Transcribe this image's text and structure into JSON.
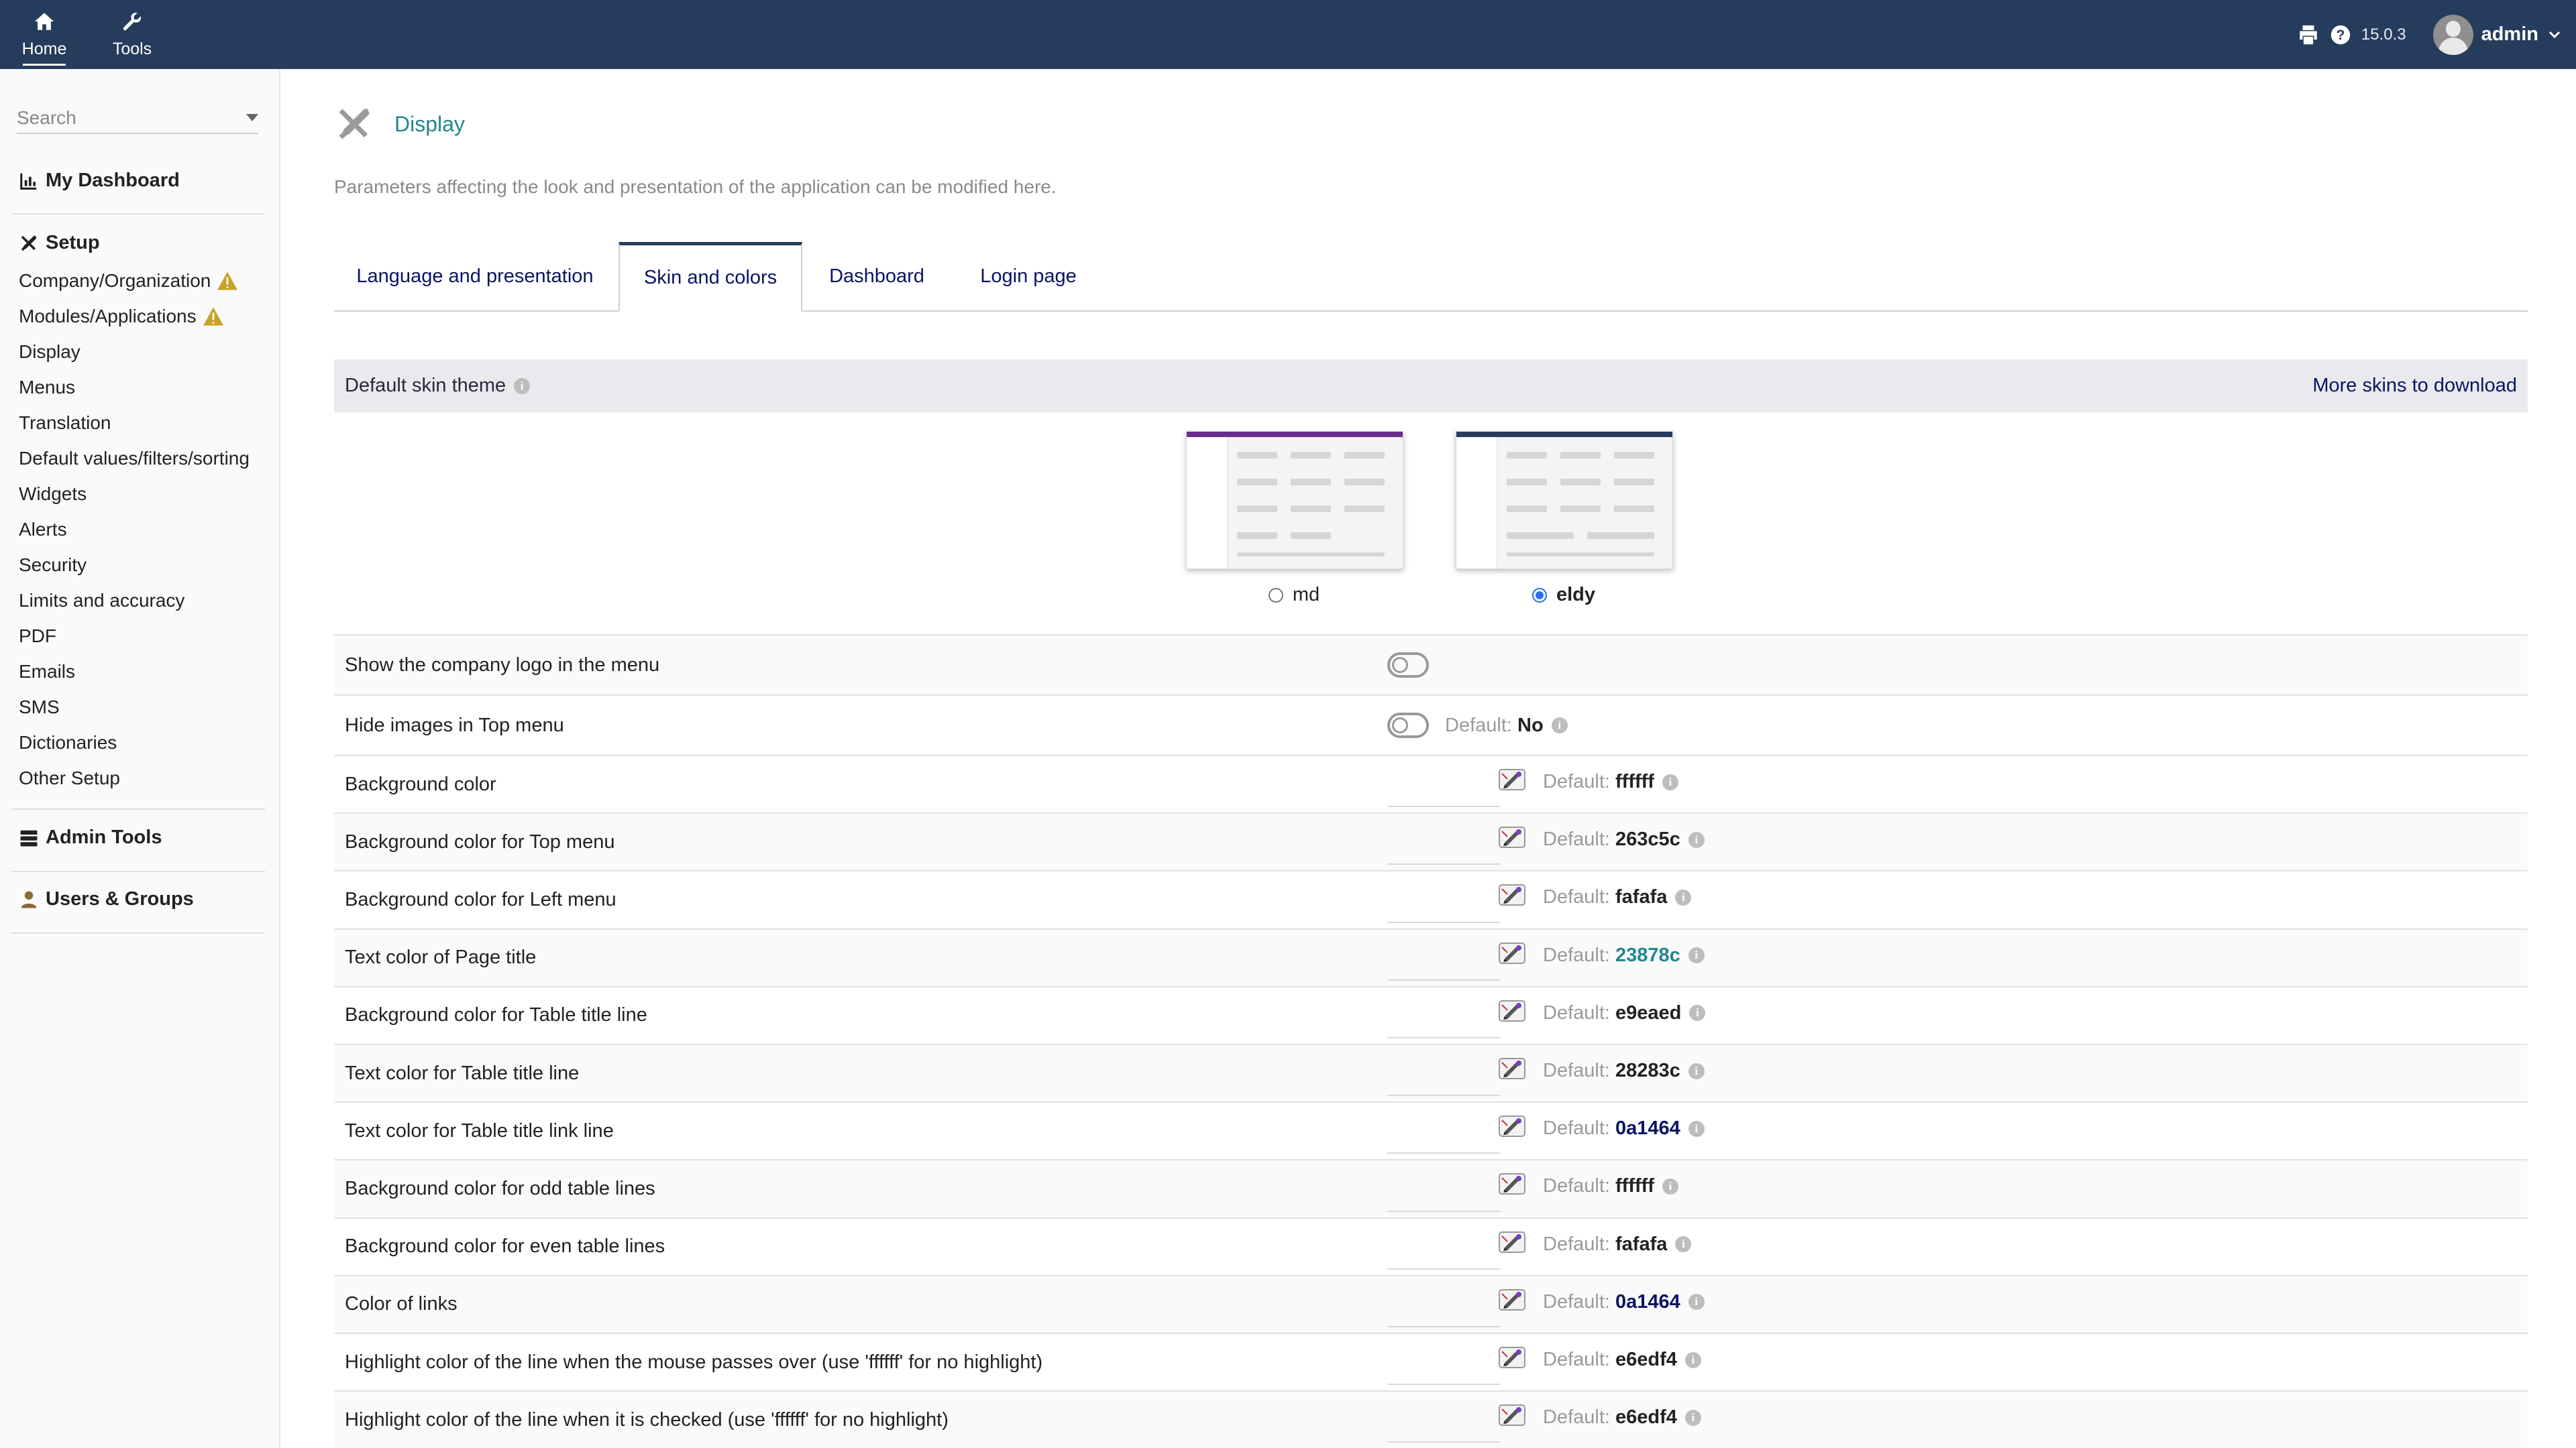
{
  "topbar": {
    "home_label": "Home",
    "tools_label": "Tools",
    "version": "15.0.3",
    "username": "admin"
  },
  "sidebar": {
    "search_placeholder": "Search",
    "dashboard": "My Dashboard",
    "setup": "Setup",
    "setup_items": [
      "Company/Organization",
      "Modules/Applications",
      "Display",
      "Menus",
      "Translation",
      "Default values/filters/sorting",
      "Widgets",
      "Alerts",
      "Security",
      "Limits and accuracy",
      "PDF",
      "Emails",
      "SMS",
      "Dictionaries",
      "Other Setup"
    ],
    "admin_tools": "Admin Tools",
    "users_groups": "Users & Groups"
  },
  "page": {
    "title": "Display",
    "description": "Parameters affecting the look and presentation of the application can be modified here."
  },
  "tabs": [
    "Language and presentation",
    "Skin and colors",
    "Dashboard",
    "Login page"
  ],
  "skin": {
    "header": "Default skin theme",
    "more_link": "More skins to download",
    "options": [
      {
        "name": "md",
        "selected": false
      },
      {
        "name": "eldy",
        "selected": true
      }
    ]
  },
  "default_label": "Default",
  "settings": [
    {
      "label": "Show the company logo in the menu",
      "type": "toggle"
    },
    {
      "label": "Hide images in Top menu",
      "type": "toggle",
      "default": "No"
    },
    {
      "label": "Background color",
      "type": "color",
      "default": "ffffff"
    },
    {
      "label": "Background color for Top menu",
      "type": "color",
      "default": "263c5c"
    },
    {
      "label": "Background color for Left menu",
      "type": "color",
      "default": "fafafa"
    },
    {
      "label": "Text color of Page title",
      "type": "color",
      "default": "23878c",
      "default_color": "#23878c"
    },
    {
      "label": "Background color for Table title line",
      "type": "color",
      "default": "e9eaed"
    },
    {
      "label": "Text color for Table title line",
      "type": "color",
      "default": "28283c"
    },
    {
      "label": "Text color for Table title link line",
      "type": "color",
      "default": "0a1464",
      "default_color": "#0a1464"
    },
    {
      "label": "Background color for odd table lines",
      "type": "color",
      "default": "ffffff"
    },
    {
      "label": "Background color for even table lines",
      "type": "color",
      "default": "fafafa"
    },
    {
      "label": "Color of links",
      "type": "color",
      "default": "0a1464",
      "default_color": "#0a1464"
    },
    {
      "label": "Highlight color of the line when the mouse passes over (use 'ffffff' for no highlight)",
      "type": "color",
      "default": "e6edf4"
    },
    {
      "label": "Highlight color of the line when it is checked (use 'ffffff' for no highlight)",
      "type": "color",
      "default": "e6edf4"
    }
  ],
  "colors": {
    "topbar_bg": "#263c5c",
    "title_color": "#23878c",
    "link_color": "#0a1464",
    "table_header_bg": "#e9eaed",
    "warning": "#c9a227"
  }
}
